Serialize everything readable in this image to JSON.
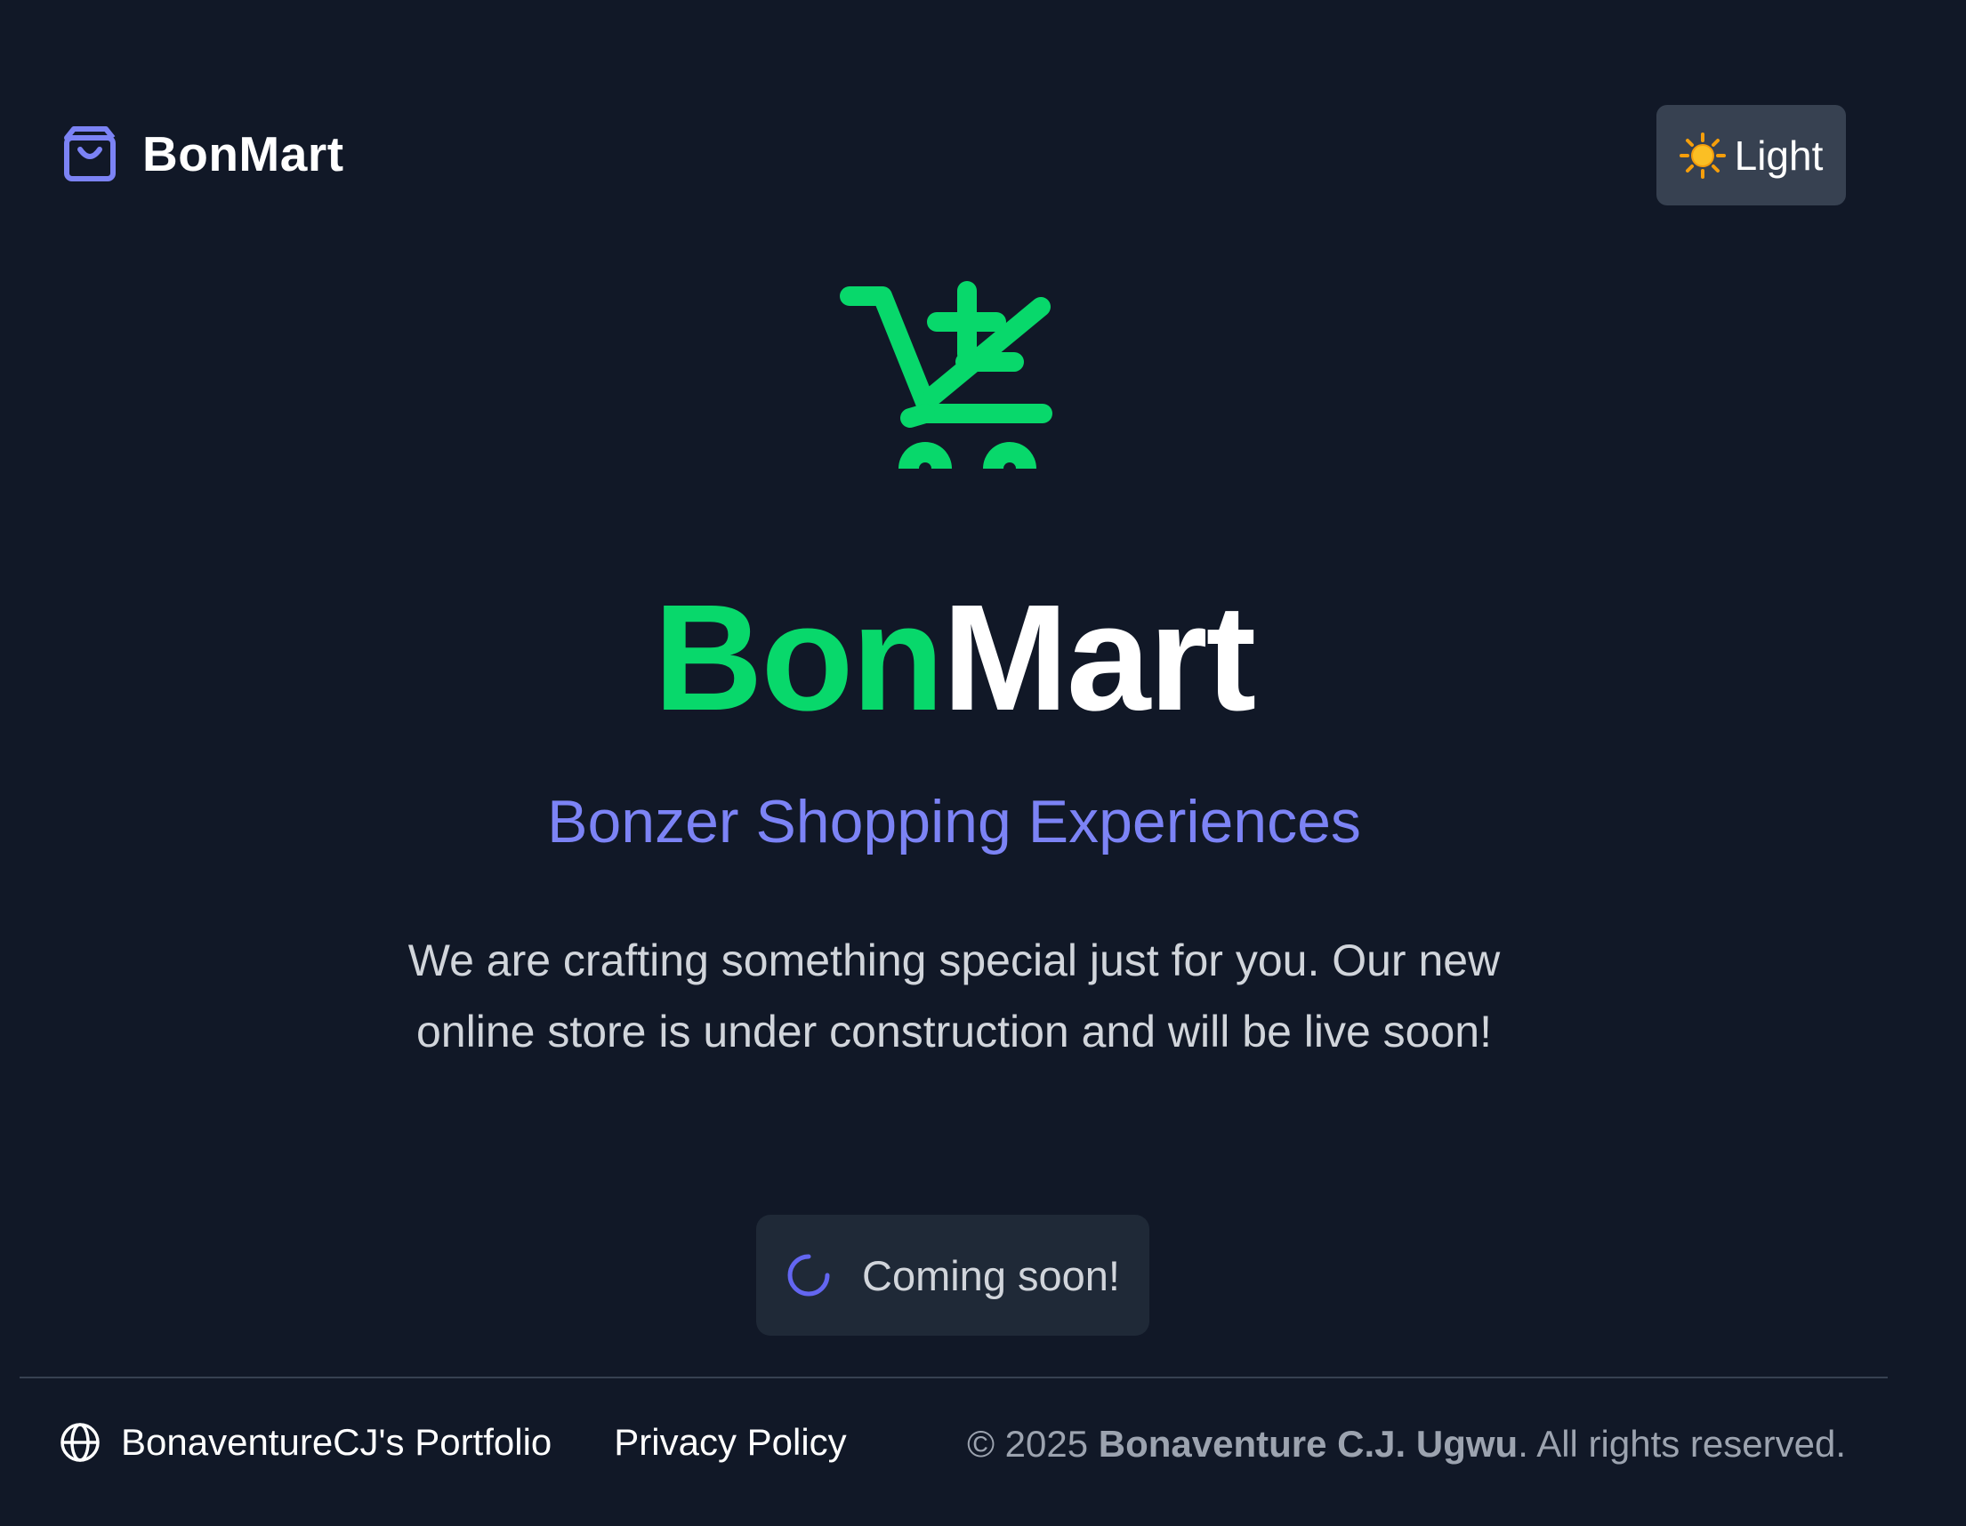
{
  "header": {
    "brand_name": "BonMart",
    "theme_toggle_label": "Light"
  },
  "hero": {
    "title_accent": "Bon",
    "title_rest": "Mart",
    "tagline": "Bonzer Shopping Experiences",
    "description": "We are crafting something special just for you. Our new online store is under construction and will be live soon!",
    "status_text": "Coming soon!"
  },
  "footer": {
    "portfolio_link": "BonaventureCJ's Portfolio",
    "privacy_link": "Privacy Policy",
    "copyright_prefix": "© 2025 ",
    "copyright_owner": "Bonaventure C.J. Ugwu",
    "copyright_suffix": ". All rights reserved."
  },
  "icons": {
    "brand": "shopping-bag-icon",
    "theme": "sun-icon",
    "hero": "cart-plus-icon",
    "status": "spinner-icon",
    "footer": "globe-icon"
  },
  "colors": {
    "background": "#111827",
    "accent_green": "#08d86b",
    "accent_indigo": "#7c83f5",
    "toggle_bg": "#374151",
    "pill_bg": "#1f2937"
  }
}
